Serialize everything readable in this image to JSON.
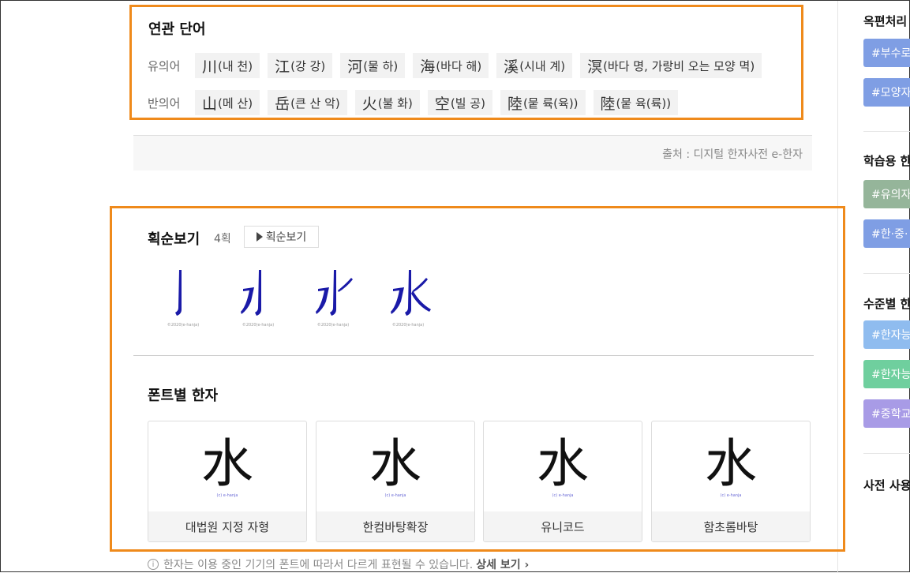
{
  "related": {
    "title": "연관 단어",
    "synonym_label": "유의어",
    "antonym_label": "반의어",
    "synonyms": [
      {
        "hanja": "川",
        "reading": "(내 천)"
      },
      {
        "hanja": "江",
        "reading": "(강 강)"
      },
      {
        "hanja": "河",
        "reading": "(물 하)"
      },
      {
        "hanja": "海",
        "reading": "(바다 해)"
      },
      {
        "hanja": "溪",
        "reading": "(시내 계)"
      },
      {
        "hanja": "溟",
        "reading": "(바다 명, 가랑비 오는 모양 멱)"
      }
    ],
    "antonyms": [
      {
        "hanja": "山",
        "reading": "(메 산)"
      },
      {
        "hanja": "岳",
        "reading": "(큰 산 악)"
      },
      {
        "hanja": "火",
        "reading": "(불 화)"
      },
      {
        "hanja": "空",
        "reading": "(빌 공)"
      },
      {
        "hanja": "陸",
        "reading": "(뭍 륙(육))"
      },
      {
        "hanja": "陸",
        "reading": "(뭍 육(륙))"
      }
    ],
    "source": "출처 : 디지털 한자사전 e-한자"
  },
  "stroke": {
    "title": "획순보기",
    "count": "4획",
    "button": "획순보기",
    "copyright": "©2020(e-hanja)"
  },
  "fonts": {
    "title": "폰트별 한자",
    "glyph": "水",
    "copyright": "(c) e-hanja",
    "cards": [
      {
        "name": "대법원 지정 자형"
      },
      {
        "name": "한컴바탕확장"
      },
      {
        "name": "유니코드"
      },
      {
        "name": "함초롬바탕"
      }
    ],
    "notice": "한자는 이용 중인 기기의 폰트에 따라서 다르게 표현될 수 있습니다.",
    "notice_link": "상세 보기 ›"
  },
  "sidebar": {
    "sections": [
      {
        "title": "옥편처리",
        "tags": [
          "#부수로",
          "#모양자"
        ]
      },
      {
        "title": "학습용 한",
        "tags": [
          "#유의자",
          "#한·중·"
        ]
      },
      {
        "title": "수준별 한",
        "tags": [
          "#한자능",
          "#한자능",
          "#중학교"
        ]
      },
      {
        "title": "사전 사용",
        "tags": []
      }
    ]
  },
  "colors": {
    "highlight_border": "#ef8a1b",
    "stroke_blue": "#1a1aa8",
    "tag_blue": "#7f9ee4",
    "tag_green": "#95b59a",
    "tag_lightblue": "#8fbcef",
    "tag_teal": "#6fcf9e",
    "tag_purple": "#a89be6"
  }
}
